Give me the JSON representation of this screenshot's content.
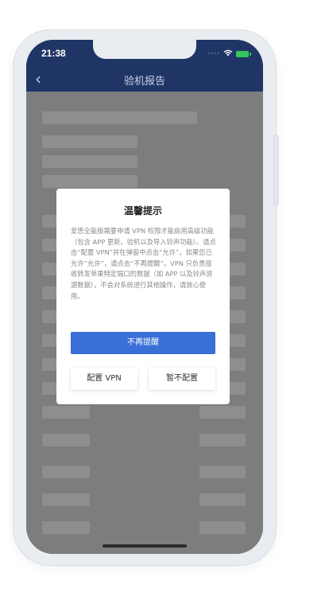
{
  "status_bar": {
    "time": "21:38",
    "signal_icon": "signal-dots-icon",
    "wifi_icon": "wifi-icon",
    "battery_icon": "battery-charging-icon"
  },
  "nav_bar": {
    "back_icon": "chevron-left-icon",
    "back_glyph": "‹",
    "title": "验机报告"
  },
  "dialog": {
    "title": "温馨提示",
    "body": "爱思全能版需要申请 VPN 权限才能启用高级功能（包含 APP 更新、验机以及导入铃声功能）。请点击“配置 VPN”并在弹窗中点击“允许”，如果您已允许“允许”，请点击“不再提醒”。VPN 只负责接收转发苹果特定端口的数据（如 APP 以及铃声资源数据），不会对系统进行其他操作，请放心使用。",
    "primary_button": "不再提醒",
    "configure_button": "配置 VPN",
    "skip_button": "暂不配置"
  },
  "colors": {
    "header_bg": "#1f3566",
    "primary_button_bg": "#3a6fd8",
    "overlay": "#7d7d7d"
  }
}
